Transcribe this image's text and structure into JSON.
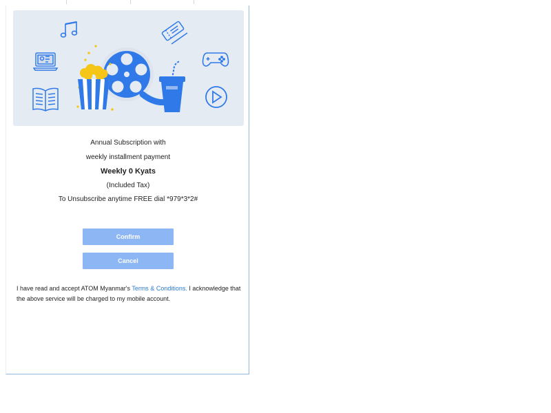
{
  "hero": {
    "illustration": "entertainment-banner",
    "icons": [
      "music-note-icon",
      "tickets-icon",
      "laptop-video-icon",
      "gamepad-icon",
      "open-book-icon",
      "play-button-icon",
      "popcorn-icon",
      "film-reel-icon",
      "soda-cup-icon"
    ],
    "colors": {
      "background": "#e5ebf3",
      "accent": "#2f79e8",
      "popcorn": "#f5c518"
    }
  },
  "offer": {
    "line1": "Annual Subscription with",
    "line2": "weekly installment payment",
    "price": "Weekly 0 Kyats",
    "tax_note": "(Included Tax)",
    "unsubscribe": "To Unsubscribe anytime FREE dial *979*3*2#"
  },
  "buttons": {
    "confirm_label": "Confirm",
    "cancel_label": "Cancel",
    "color": "#8db6f4"
  },
  "consent": {
    "prefix": "I have read and accept ATOM Myanmar's ",
    "terms_link": "Terms & Conditions.",
    "suffix": " I acknowledge that the above service will be charged to my mobile account.",
    "link_color": "#2a7ad6"
  }
}
